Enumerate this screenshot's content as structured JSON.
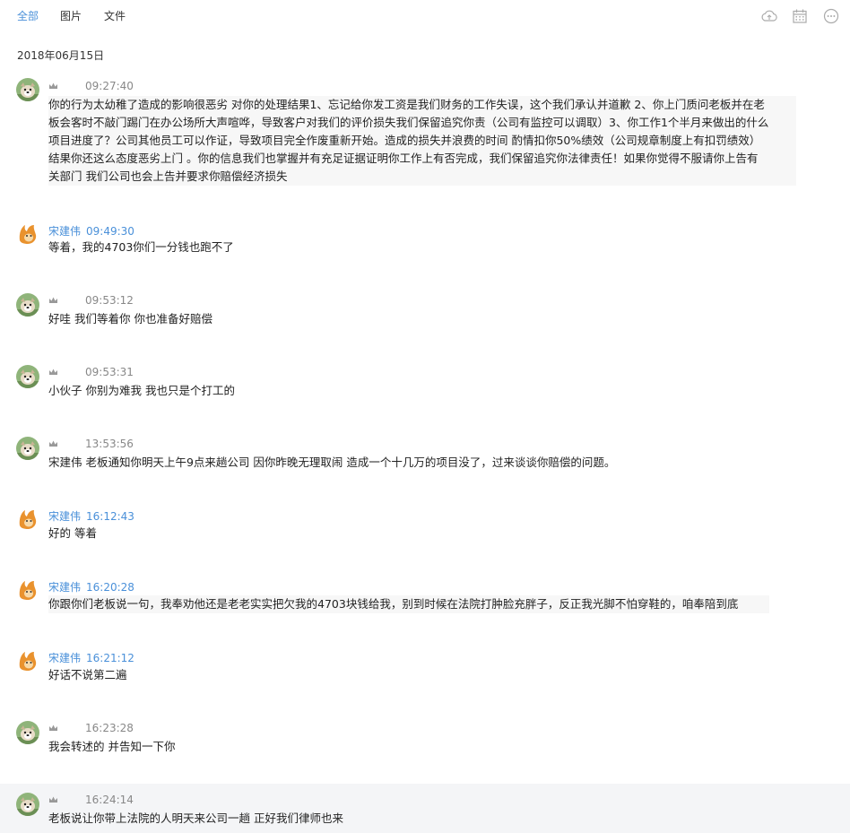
{
  "tabs": [
    "全部",
    "图片",
    "文件"
  ],
  "toolbar_icons": [
    "cloud-icon",
    "calendar-icon",
    "more-icon"
  ],
  "date_header": "2018年06月15日",
  "colors": {
    "accent": "#4a90d9",
    "text": "#222222",
    "meta": "#888888"
  },
  "messages": [
    {
      "sender": "",
      "avatar": "dog-avatar-icon",
      "crown": true,
      "time": "09:27:40",
      "lines": [
        "你的行为太幼稚了造成的影响很恶劣  对你的处理结果1、忘记给你发工资是我们财务的工作失误，这个我们承认并道歉 2、你上门质问老板并在老",
        "板会客时不敲门踢门在办公场所大声喧哗，导致客户对我们的评价损失我们保留追究你责（公司有监控可以调取）3、你工作1个半月来做出的什么",
        "项目进度了？公司其他员工可以作证，导致项目完全作废重新开始。造成的损失并浪费的时间 酌情扣你50%绩效（公司规章制度上有扣罚绩效）",
        "结果你还这么态度恶劣上门 。你的信息我们也掌握并有充足证据证明你工作上有否完成，我们保留追究你法律责任！如果你觉得不服请你上告有",
        "关部门 我们公司也会上告并要求你赔偿经济损失"
      ]
    },
    {
      "sender": "宋建伟",
      "avatar": "fox-avatar-icon",
      "crown": false,
      "time": "09:49:30",
      "lines": [
        "等着，我的4703你们一分钱也跑不了"
      ]
    },
    {
      "sender": "",
      "avatar": "dog-avatar-icon",
      "crown": true,
      "time": "09:53:12",
      "lines": [
        "好哇  我们等着你  你也准备好赔偿"
      ]
    },
    {
      "sender": "",
      "avatar": "dog-avatar-icon",
      "crown": true,
      "time": "09:53:31",
      "lines": [
        "小伙子 你别为难我 我也只是个打工的"
      ]
    },
    {
      "sender": "",
      "avatar": "dog-avatar-icon",
      "crown": true,
      "time": "13:53:56",
      "lines": [
        "宋建伟 老板通知你明天上午9点来趟公司 因你昨晚无理取闹 造成一个十几万的项目没了，过来谈谈你赔偿的问题。"
      ]
    },
    {
      "sender": "宋建伟",
      "avatar": "fox-avatar-icon",
      "crown": false,
      "time": "16:12:43",
      "lines": [
        "好的 等着"
      ]
    },
    {
      "sender": "宋建伟",
      "avatar": "fox-avatar-icon",
      "crown": false,
      "time": "16:20:28",
      "lines": [
        "你跟你们老板说一句，我奉劝他还是老老实实把欠我的4703块钱给我，别到时候在法院打肿脸充胖子，反正我光脚不怕穿鞋的，咱奉陪到底"
      ]
    },
    {
      "sender": "宋建伟",
      "avatar": "fox-avatar-icon",
      "crown": false,
      "time": "16:21:12",
      "lines": [
        "好话不说第二遍"
      ]
    },
    {
      "sender": "",
      "avatar": "dog-avatar-icon",
      "crown": true,
      "time": "16:23:28",
      "lines": [
        "我会转述的 并告知一下你"
      ]
    },
    {
      "sender": "",
      "avatar": "dog-avatar-icon",
      "crown": true,
      "time": "16:24:14",
      "lines": [
        "老板说让你带上法院的人明天来公司一趟 正好我们律师也来"
      ]
    }
  ]
}
